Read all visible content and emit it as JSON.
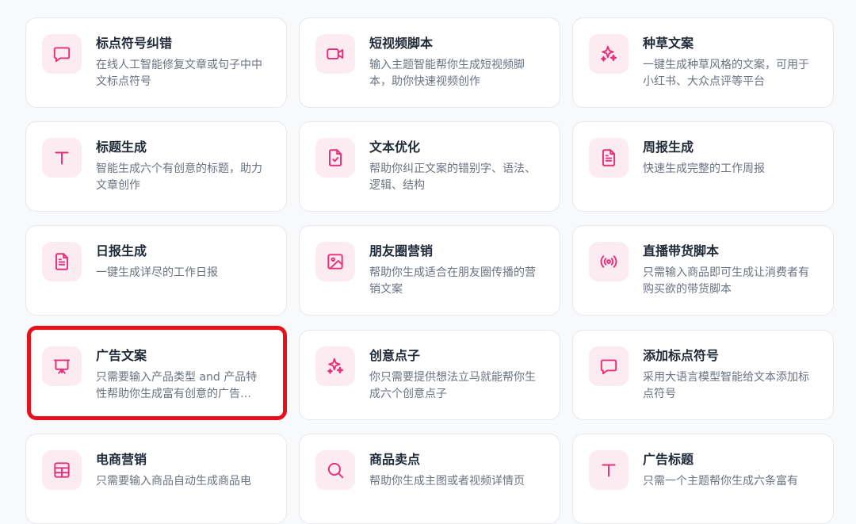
{
  "theme": {
    "accent": "#e6307a",
    "icon_bg": "#fdebf2",
    "highlight": "#e8111b"
  },
  "cards": [
    {
      "icon": "message-square-icon",
      "title": "标点符号纠错",
      "desc": "在线人工智能修复文章或句子中中文标点符号"
    },
    {
      "icon": "video-camera-icon",
      "title": "短视频脚本",
      "desc": "输入主题智能帮你生成短视频脚本，助你快速视频创作"
    },
    {
      "icon": "sparkles-icon",
      "title": "种草文案",
      "desc": "一键生成种草风格的文案，可用于小红书、大众点评等平台"
    },
    {
      "icon": "text-t-icon",
      "title": "标题生成",
      "desc": "智能生成六个有创意的标题，助力文章创作"
    },
    {
      "icon": "file-check-icon",
      "title": "文本优化",
      "desc": "帮助你纠正文案的错别字、语法、逻辑、结构"
    },
    {
      "icon": "file-text-icon",
      "title": "周报生成",
      "desc": "快速生成完整的工作周报"
    },
    {
      "icon": "file-text-icon",
      "title": "日报生成",
      "desc": "一键生成详尽的工作日报"
    },
    {
      "icon": "image-icon",
      "title": "朋友圈营销",
      "desc": "帮助你生成适合在朋友圈传播的营销文案"
    },
    {
      "icon": "broadcast-icon",
      "title": "直播带货脚本",
      "desc": "只需输入商品即可生成让消费者有购买欲的带货脚本"
    },
    {
      "icon": "presentation-icon",
      "title": "广告文案",
      "desc": "只需要输入产品类型 and 产品特性帮助你生成富有创意的广告…"
    },
    {
      "icon": "sparkles-icon",
      "title": "创意点子",
      "desc": "你只需要提供想法立马就能帮你生成六个创意点子"
    },
    {
      "icon": "message-square-icon",
      "title": "添加标点符号",
      "desc": "采用大语言模型智能给文本添加标点符号"
    },
    {
      "icon": "table-grid-icon",
      "title": "电商营销",
      "desc": "只需要输入商品自动生成商品电"
    },
    {
      "icon": "search-icon",
      "title": "商品卖点",
      "desc": "帮助你生成主图或者视频详情页"
    },
    {
      "icon": "text-t-icon",
      "title": "广告标题",
      "desc": "只需一个主题帮你生成六条富有"
    }
  ]
}
